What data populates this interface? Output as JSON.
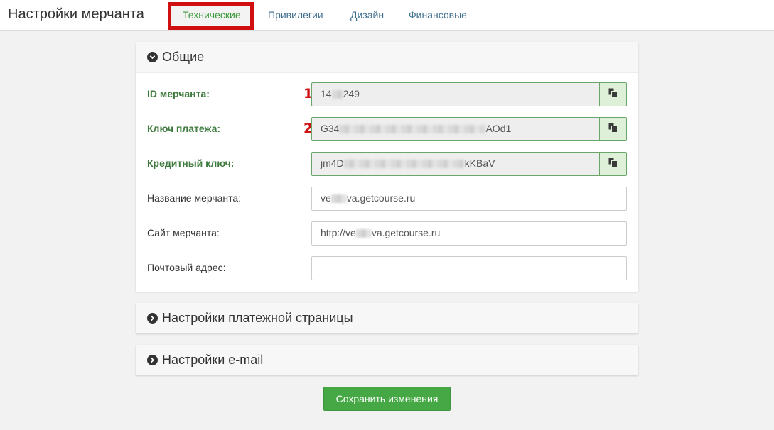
{
  "header": {
    "title": "Настройки мерчанта",
    "tabs": [
      {
        "label": "Технические",
        "active": true
      },
      {
        "label": "Привилегии",
        "active": false
      },
      {
        "label": "Дизайн",
        "active": false
      },
      {
        "label": "Финансовые",
        "active": false
      }
    ]
  },
  "general": {
    "title": "Общие",
    "fields": {
      "merchant_id": {
        "label": "ID мерчанта:",
        "value_start": "14",
        "value_end": "249",
        "marker": "1"
      },
      "payment_key": {
        "label": "Ключ платежа:",
        "value_start": "G34",
        "value_end": "AOd1",
        "marker": "2"
      },
      "credit_key": {
        "label": "Кредитный ключ:",
        "value_start": "jm4D",
        "value_end": "kKBaV"
      },
      "merchant_name": {
        "label": "Название мерчанта:",
        "value_start": "ve",
        "value_end": "va.getcourse.ru"
      },
      "merchant_site": {
        "label": "Сайт мерчанта:",
        "value_start": "http://ve",
        "value_end": "va.getcourse.ru"
      },
      "email": {
        "label": "Почтовый адрес:",
        "value": ""
      }
    }
  },
  "payment_page": {
    "title": "Настройки платежной страницы"
  },
  "email_settings": {
    "title": "Настройки e-mail"
  },
  "save_label": "Сохранить изменения",
  "colors": {
    "accent_green": "#45a845",
    "highlight_red": "#d01010",
    "label_green": "#3f7a3f"
  },
  "icons": {
    "copy": "clipboard-icon",
    "expanded": "chevron-down-circle-icon",
    "collapsed": "chevron-right-circle-icon"
  }
}
